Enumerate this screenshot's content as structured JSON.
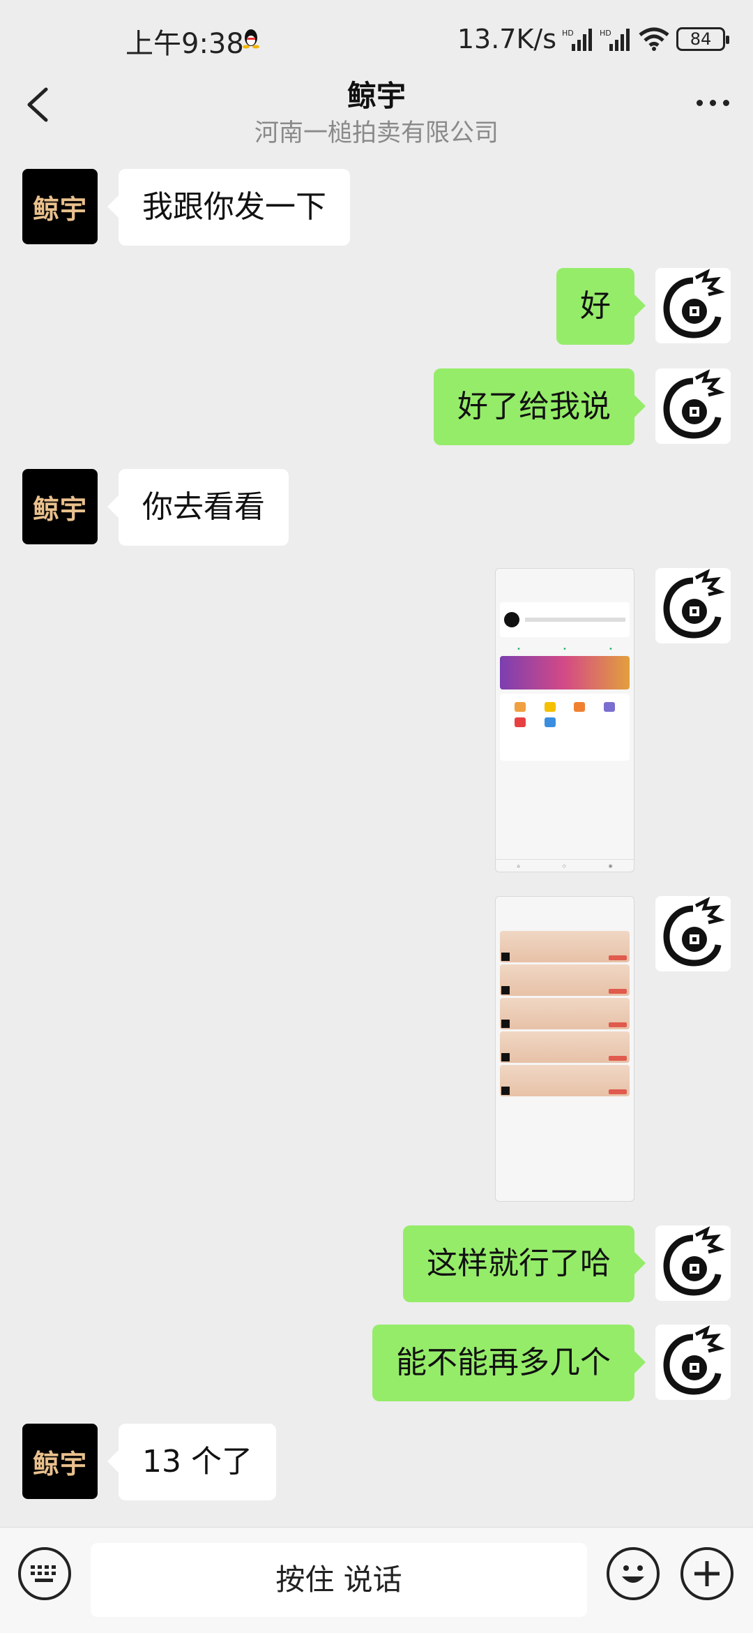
{
  "status_bar": {
    "time": "上午9:38",
    "network_speed": "13.7K/s",
    "battery": "84"
  },
  "header": {
    "title": "鲸宇",
    "subtitle": "河南一槌拍卖有限公司"
  },
  "contact_avatar_text": "鲸宇",
  "messages": [
    {
      "side": "left",
      "text": "我跟你发一下"
    },
    {
      "side": "right",
      "text": "好"
    },
    {
      "side": "right",
      "text": "好了给我说"
    },
    {
      "side": "left",
      "text": "你去看看"
    },
    {
      "side": "right",
      "type": "image"
    },
    {
      "side": "right",
      "type": "image"
    },
    {
      "side": "right",
      "text": "这样就行了哈"
    },
    {
      "side": "right",
      "text": "能不能再多几个"
    },
    {
      "side": "left",
      "text": "13 个了"
    }
  ],
  "input_bar": {
    "hold_to_talk": "按住 说话"
  },
  "colors": {
    "background": "#ededed",
    "my_bubble": "#95ec69",
    "their_bubble": "#ffffff",
    "contact_avatar_bg": "#000000",
    "contact_avatar_text": "#e9c08d"
  },
  "icons": [
    "back-icon",
    "more-icon",
    "keyboard-icon",
    "emoji-icon",
    "plus-icon",
    "qq-penguin-icon",
    "signal-icon",
    "wifi-icon",
    "battery-icon"
  ]
}
